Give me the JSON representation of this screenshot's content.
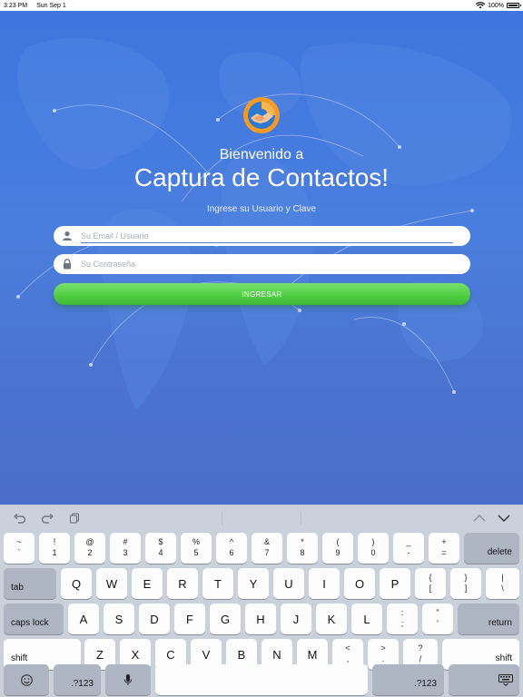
{
  "status_bar": {
    "time": "3:23 PM",
    "date": "Sun Sep 1",
    "battery": "100%"
  },
  "login": {
    "welcome": "Bienvenido a",
    "app_name": "Captura de Contactos!",
    "subtitle": "Ingrese su Usuario y Clave",
    "email_placeholder": "Su Email / Usuario",
    "password_placeholder": "Su Contraseña",
    "login_button": "INGRESAR"
  },
  "keyboard": {
    "toolbar": {
      "left": [
        "undo-icon",
        "redo-icon",
        "paste-icon"
      ],
      "right": [
        "chevron-up-icon",
        "chevron-down-icon"
      ]
    },
    "row1": [
      {
        "top": "~",
        "bottom": "`"
      },
      {
        "top": "!",
        "bottom": "1"
      },
      {
        "top": "@",
        "bottom": "2"
      },
      {
        "top": "#",
        "bottom": "3"
      },
      {
        "top": "$",
        "bottom": "4"
      },
      {
        "top": "%",
        "bottom": "5"
      },
      {
        "top": "^",
        "bottom": "6"
      },
      {
        "top": "&",
        "bottom": "7"
      },
      {
        "top": "*",
        "bottom": "8"
      },
      {
        "top": "(",
        "bottom": "9"
      },
      {
        "top": ")",
        "bottom": "0"
      },
      {
        "top": "_",
        "bottom": "-"
      },
      {
        "top": "+",
        "bottom": "="
      }
    ],
    "delete": "delete",
    "tab": "tab",
    "row2": [
      "Q",
      "W",
      "E",
      "R",
      "T",
      "Y",
      "U",
      "I",
      "O",
      "P"
    ],
    "row2_symbols": [
      {
        "top": "{",
        "bottom": "["
      },
      {
        "top": "}",
        "bottom": "]"
      },
      {
        "top": "|",
        "bottom": "\\"
      }
    ],
    "caps_lock": "caps lock",
    "row3": [
      "A",
      "S",
      "D",
      "F",
      "G",
      "H",
      "J",
      "K",
      "L"
    ],
    "row3_symbols": [
      {
        "top": ":",
        "bottom": ";"
      },
      {
        "top": "\"",
        "bottom": "'"
      }
    ],
    "return": "return",
    "shift": "shift",
    "row4": [
      "Z",
      "X",
      "C",
      "V",
      "B",
      "N",
      "M"
    ],
    "row4_symbols": [
      {
        "top": "<",
        "bottom": ","
      },
      {
        "top": ">",
        "bottom": "."
      },
      {
        "top": "?",
        "bottom": "/"
      }
    ],
    "numbers_key": ".?123",
    "bottom_icons": {
      "emoji": "emoji-icon",
      "mic": "microphone-icon",
      "dismiss": "keyboard-dismiss-icon"
    }
  }
}
